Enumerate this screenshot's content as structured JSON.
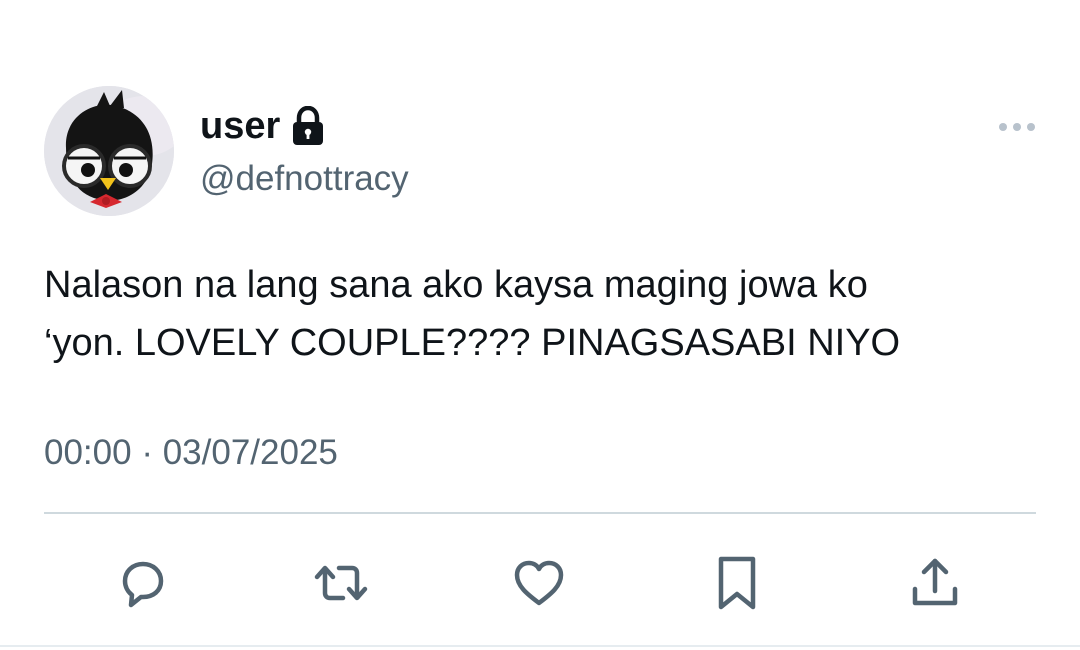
{
  "author": {
    "display_name": "user",
    "handle": "@defnottracy",
    "protected_icon": "lock-icon",
    "avatar": "avatar-plush-character"
  },
  "tweet": {
    "text": "Nalason na lang sana ako kaysa maging jowa ko\n‘yon. LOVELY COUPLE???? PINAGSASABI NIYO",
    "time": "00:00",
    "separator": "·",
    "date": "03/07/2025"
  },
  "actions": [
    {
      "name": "reply",
      "icon": "reply-icon"
    },
    {
      "name": "retweet",
      "icon": "retweet-icon"
    },
    {
      "name": "like",
      "icon": "heart-icon"
    },
    {
      "name": "bookmark",
      "icon": "bookmark-icon"
    },
    {
      "name": "share",
      "icon": "share-icon"
    }
  ],
  "colors": {
    "text_primary": "#0f1419",
    "text_secondary": "#536471",
    "divider": "#cfd9de",
    "action_icon": "#536471"
  }
}
